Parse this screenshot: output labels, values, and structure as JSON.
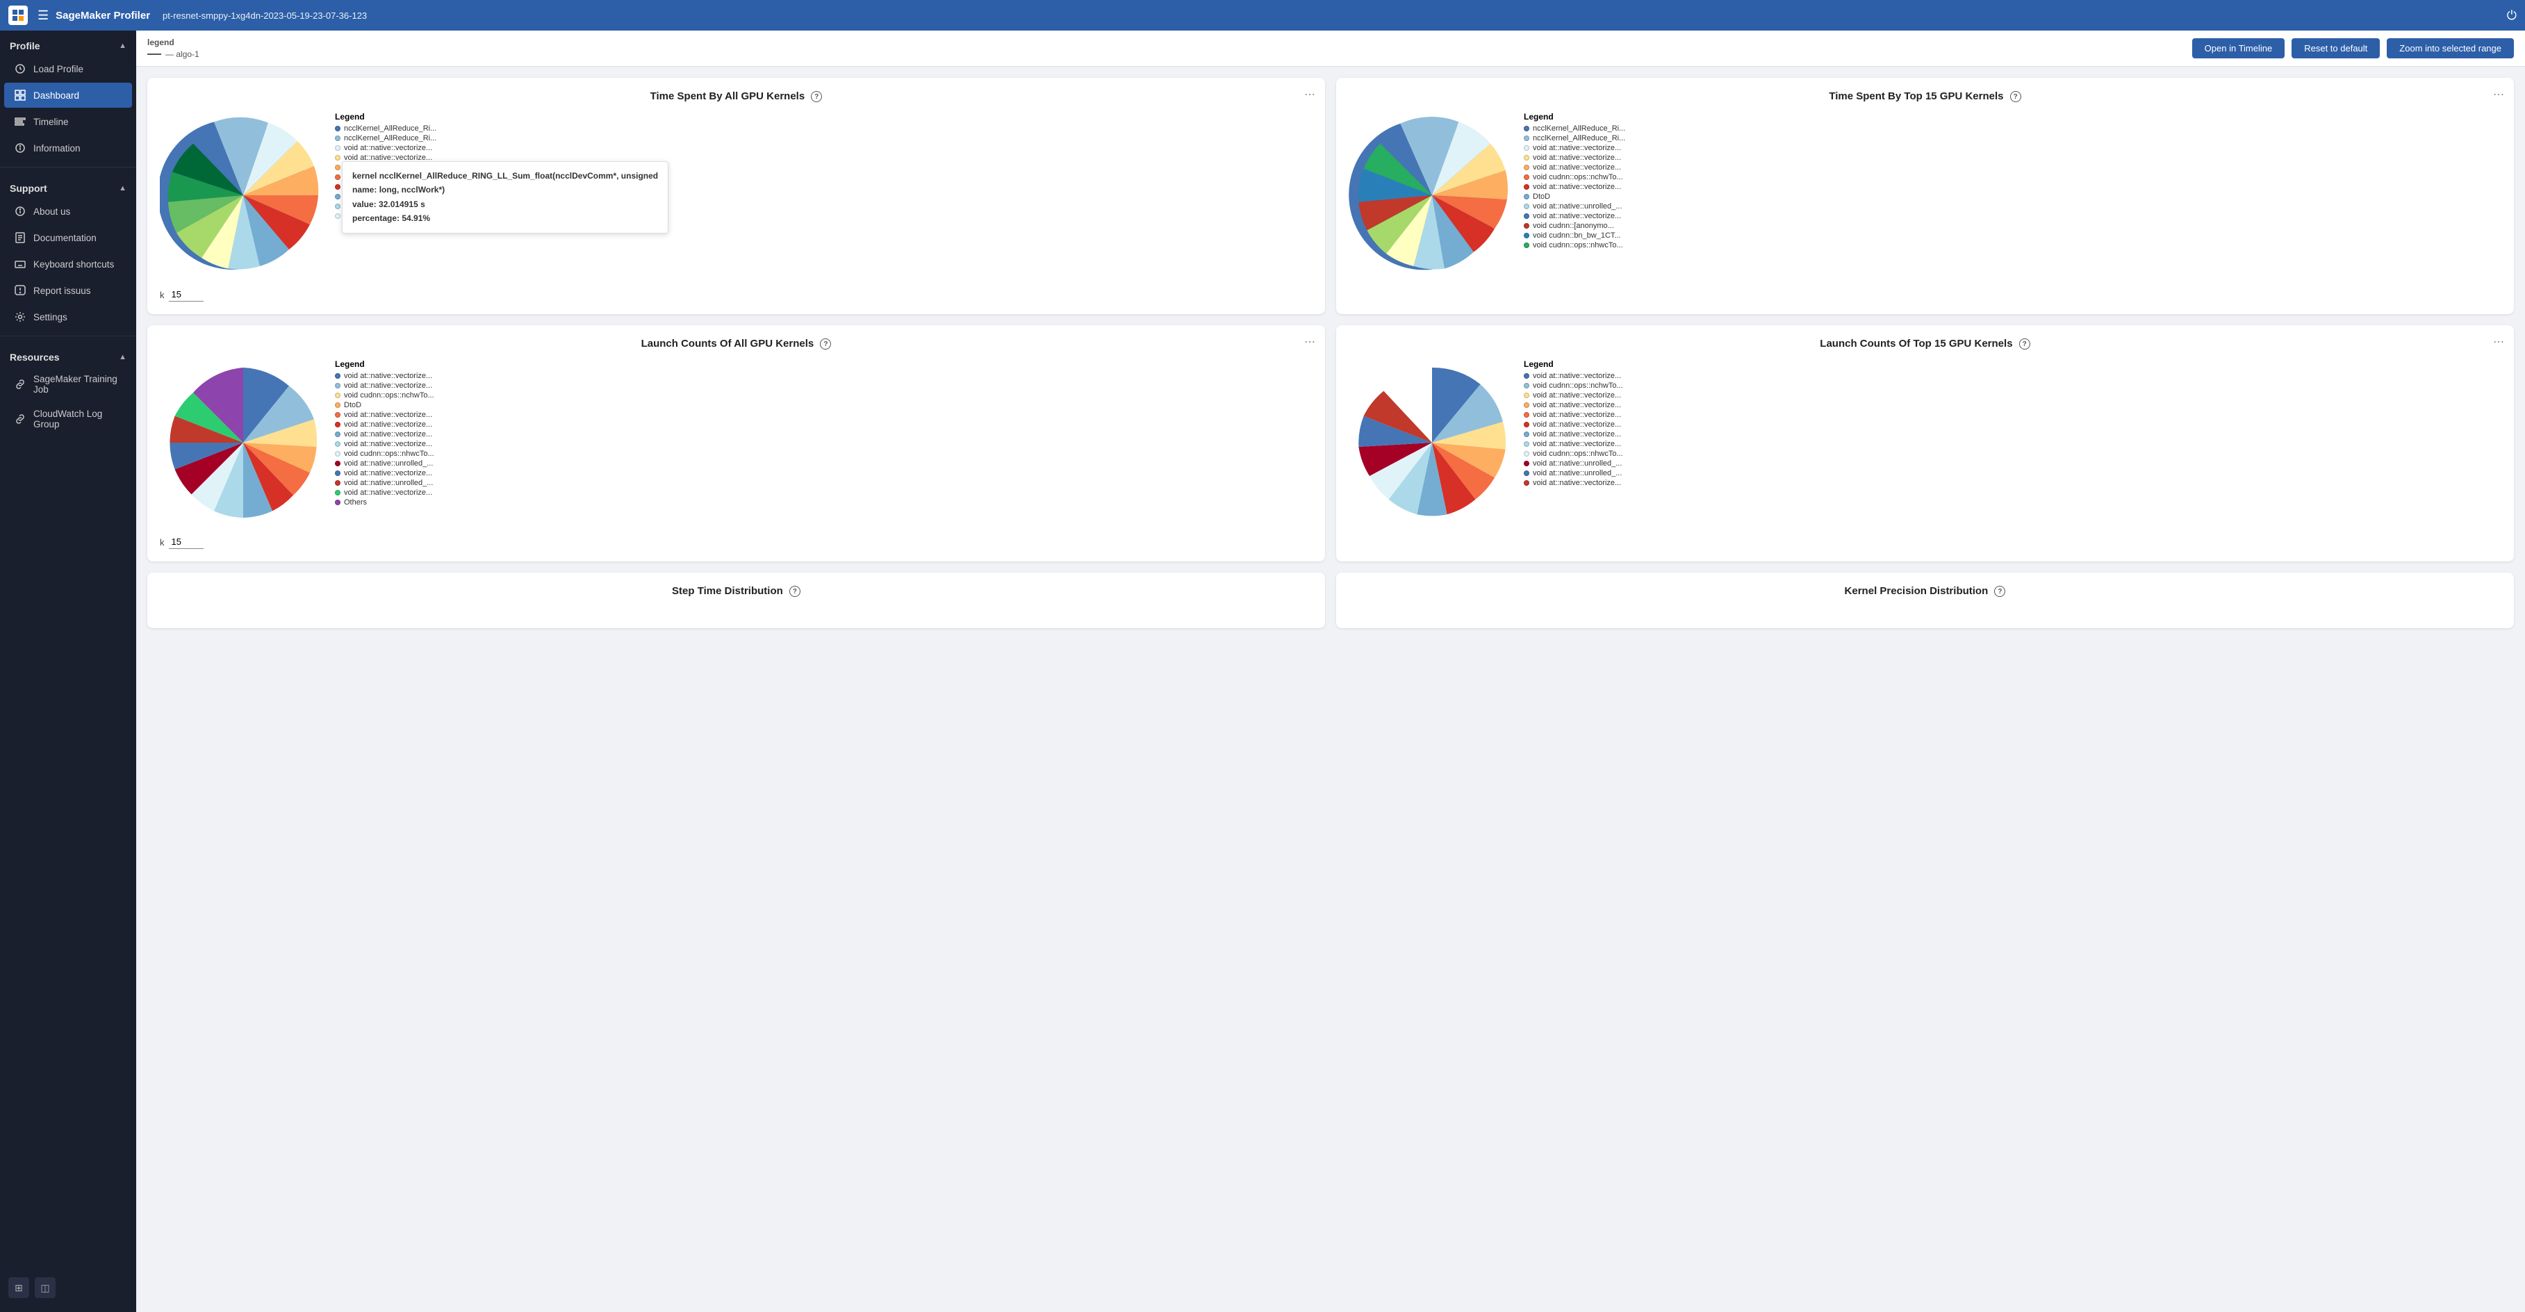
{
  "topbar": {
    "logo_alt": "SageMaker",
    "title": "SageMaker Profiler",
    "filename": "pt-resnet-smppy-1xg4dn-2023-05-19-23-07-36-123",
    "power_icon": "⏻"
  },
  "sidebar": {
    "profile_section": "Profile",
    "profile_chevron": "▲",
    "load_profile_label": "Load Profile",
    "dashboard_label": "Dashboard",
    "timeline_label": "Timeline",
    "information_label": "Information",
    "support_section": "Support",
    "support_chevron": "▲",
    "about_us_label": "About us",
    "documentation_label": "Documentation",
    "keyboard_shortcuts_label": "Keyboard shortcuts",
    "report_issues_label": "Report issuus",
    "settings_label": "Settings",
    "resources_section": "Resources",
    "resources_chevron": "▲",
    "sagemaker_training_label": "SageMaker Training Job",
    "cloudwatch_label": "CloudWatch Log Group"
  },
  "timeline_bar": {
    "legend_title": "legend",
    "legend_item": "— algo-1",
    "open_timeline_btn": "Open in Timeline",
    "reset_default_btn": "Reset to default",
    "zoom_selected_btn": "Zoom into selected range"
  },
  "charts": [
    {
      "id": "chart1",
      "title": "Time Spent By All GPU Kernels",
      "k_label": "k",
      "k_value": "15",
      "tooltip": {
        "kernel": "ncclKernel_AllReduce_RING_LL_Sum_float(ncclDevComm*, unsigned",
        "name": "long, ncclWork*)",
        "value": "32.014915 s",
        "percentage": "54.91%"
      },
      "legend_items": [
        {
          "color": "#4575b4",
          "label": "ncclKernel_AllReduce_Ri..."
        },
        {
          "color": "#91bfdb",
          "label": "ncclKernel_AllReduce_Ri..."
        },
        {
          "color": "#e0f3f8",
          "label": "void at::native::vectorize..."
        },
        {
          "color": "#fee090",
          "label": "void at::native::vectorize..."
        },
        {
          "color": "#fdae61",
          "label": "void at::native::vectorize..."
        },
        {
          "color": "#f46d43",
          "label": "void cudnn::ops::nchwTo..."
        },
        {
          "color": "#d73027",
          "label": "void at::native::vectorize..."
        },
        {
          "color": "#74add1",
          "label": "DtoD"
        },
        {
          "color": "#abd9e9",
          "label": "void at::native::unrolled_..."
        },
        {
          "color": "#e0f3f8",
          "label": "void at::native::vectorize..."
        }
      ]
    },
    {
      "id": "chart2",
      "title": "Time Spent By Top 15 GPU Kernels",
      "k_label": "",
      "k_value": "",
      "legend_items": [
        {
          "color": "#4575b4",
          "label": "ncclKernel_AllReduce_Ri..."
        },
        {
          "color": "#91bfdb",
          "label": "ncclKernel_AllReduce_Ri..."
        },
        {
          "color": "#e0f3f8",
          "label": "void at::native::vectorize..."
        },
        {
          "color": "#fee090",
          "label": "void at::native::vectorize..."
        },
        {
          "color": "#fdae61",
          "label": "void at::native::vectorize..."
        },
        {
          "color": "#f46d43",
          "label": "void cudnn::ops::nchwTo..."
        },
        {
          "color": "#d73027",
          "label": "void at::native::vectorize..."
        },
        {
          "color": "#74add1",
          "label": "DtoD"
        },
        {
          "color": "#abd9e9",
          "label": "void at::native::unrolled_..."
        },
        {
          "color": "#4575b4",
          "label": "void at::native::vectorize..."
        },
        {
          "color": "#c0392b",
          "label": "void cudnn::[anonymo..."
        },
        {
          "color": "#2980b9",
          "label": "void cudnn::bn_bw_1CT..."
        },
        {
          "color": "#27ae60",
          "label": "void cudnn::ops::nhwcTo..."
        }
      ]
    },
    {
      "id": "chart3",
      "title": "Launch Counts Of All GPU Kernels",
      "k_label": "k",
      "k_value": "15",
      "legend_items": [
        {
          "color": "#4575b4",
          "label": "void at::native::vectorize..."
        },
        {
          "color": "#91bfdb",
          "label": "void at::native::vectorize..."
        },
        {
          "color": "#fee090",
          "label": "void cudnn::ops::nchwTo..."
        },
        {
          "color": "#fdae61",
          "label": "DtoD"
        },
        {
          "color": "#f46d43",
          "label": "void at::native::vectorize..."
        },
        {
          "color": "#d73027",
          "label": "void at::native::vectorize..."
        },
        {
          "color": "#74add1",
          "label": "void at::native::vectorize..."
        },
        {
          "color": "#abd9e9",
          "label": "void at::native::vectorize..."
        },
        {
          "color": "#e0f3f8",
          "label": "void cudnn::ops::nhwcTo..."
        },
        {
          "color": "#a50026",
          "label": "void at::native::unrolled_..."
        },
        {
          "color": "#4575b4",
          "label": "void at::native::vectorize..."
        },
        {
          "color": "#c0392b",
          "label": "void at::native::unrolled_..."
        },
        {
          "color": "#2ecc71",
          "label": "void at::native::vectorize..."
        },
        {
          "color": "#8e44ad",
          "label": "Others"
        }
      ]
    },
    {
      "id": "chart4",
      "title": "Launch Counts Of Top 15 GPU Kernels",
      "k_label": "",
      "k_value": "",
      "legend_items": [
        {
          "color": "#4575b4",
          "label": "void at::native::vectorize..."
        },
        {
          "color": "#91bfdb",
          "label": "void cudnn::ops::nchwTo..."
        },
        {
          "color": "#fee090",
          "label": "void at::native::vectorize..."
        },
        {
          "color": "#fdae61",
          "label": "void at::native::vectorize..."
        },
        {
          "color": "#f46d43",
          "label": "void at::native::vectorize..."
        },
        {
          "color": "#d73027",
          "label": "void at::native::vectorize..."
        },
        {
          "color": "#74add1",
          "label": "void at::native::vectorize..."
        },
        {
          "color": "#abd9e9",
          "label": "void at::native::vectorize..."
        },
        {
          "color": "#e0f3f8",
          "label": "void cudnn::ops::nhwcTo..."
        },
        {
          "color": "#a50026",
          "label": "void at::native::unrolled_..."
        },
        {
          "color": "#4575b4",
          "label": "void at::native::unrolled_..."
        },
        {
          "color": "#c0392b",
          "label": "void at::native::vectorize..."
        }
      ]
    }
  ],
  "bottom_charts": [
    {
      "title": "Step Time Distribution"
    },
    {
      "title": "Kernel Precision Distribution"
    }
  ]
}
